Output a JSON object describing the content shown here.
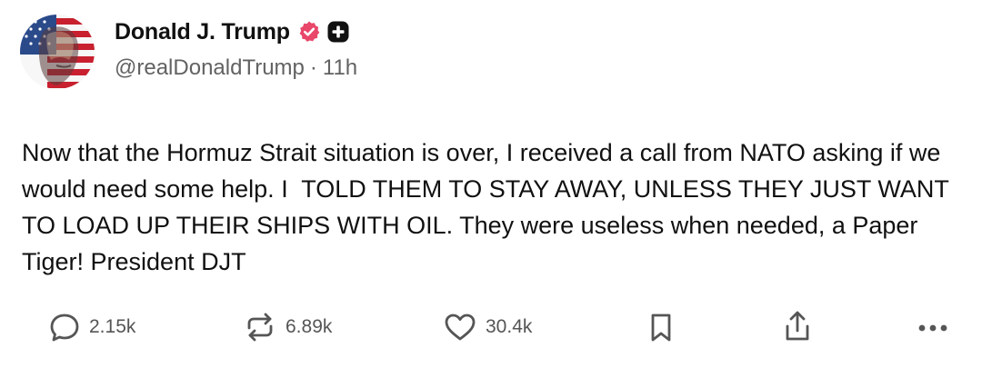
{
  "author": {
    "name": "Donald J. Trump",
    "handle": "@realDonaldTrump",
    "separator": "·",
    "time": "11h"
  },
  "post": {
    "text": "Now that the Hormuz Strait situation is over, I received a call from NATO asking if we would need some help. I  TOLD THEM TO STAY AWAY, UNLESS THEY JUST WANT TO LOAD UP THEIR SHIPS WITH OIL. They were useless when needed, a Paper Tiger! President DJT"
  },
  "actions": {
    "replies": "2.15k",
    "reposts": "6.89k",
    "likes": "30.4k"
  },
  "icons": {
    "verified": "verified-badge-icon",
    "plus": "plus-badge-icon",
    "reply": "speech-bubble-icon",
    "repost": "repost-arrows-icon",
    "like": "heart-icon",
    "bookmark": "bookmark-icon",
    "share": "share-upload-icon",
    "more": "ellipsis-icon"
  },
  "colors": {
    "verified_badge": "#e8476a",
    "text": "#111111",
    "muted": "#626262"
  }
}
